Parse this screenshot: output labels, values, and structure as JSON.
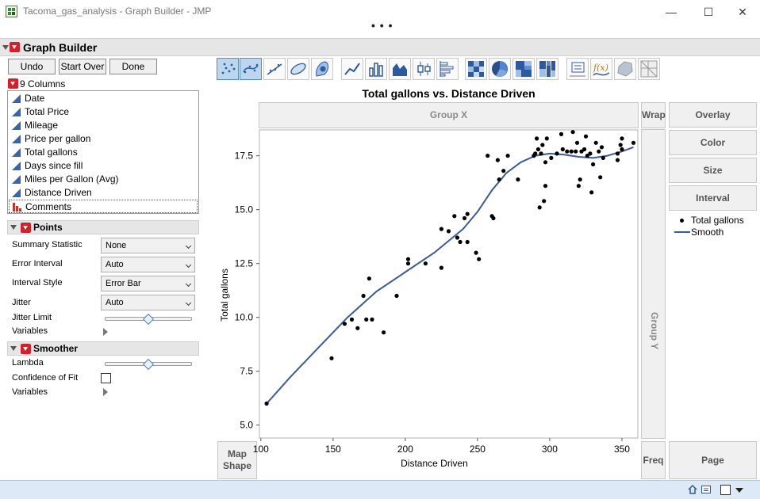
{
  "window": {
    "title": "Tacoma_gas_analysis - Graph Builder - JMP",
    "min": "—",
    "max": "☐",
    "close": "✕",
    "more": "• • •"
  },
  "header": {
    "title": "Graph Builder"
  },
  "buttons": {
    "undo": "Undo",
    "start_over": "Start Over",
    "done": "Done"
  },
  "columns": {
    "header": "9 Columns",
    "items": [
      {
        "label": "Date",
        "type": "continuous"
      },
      {
        "label": "Total Price",
        "type": "continuous"
      },
      {
        "label": "Mileage",
        "type": "continuous"
      },
      {
        "label": "Price per gallon",
        "type": "continuous"
      },
      {
        "label": "Total gallons",
        "type": "continuous"
      },
      {
        "label": "Days since fill",
        "type": "continuous"
      },
      {
        "label": "Miles per Gallon (Avg)",
        "type": "continuous"
      },
      {
        "label": "Distance Driven",
        "type": "continuous"
      },
      {
        "label": "Comments",
        "type": "nominal"
      }
    ]
  },
  "points_panel": {
    "title": "Points",
    "summary_statistic": {
      "label": "Summary Statistic",
      "value": "None"
    },
    "error_interval": {
      "label": "Error Interval",
      "value": "Auto"
    },
    "interval_style": {
      "label": "Interval Style",
      "value": "Error Bar"
    },
    "jitter": {
      "label": "Jitter",
      "value": "Auto"
    },
    "jitter_limit": {
      "label": "Jitter Limit",
      "level": 0.5
    },
    "variables": {
      "label": "Variables"
    }
  },
  "smoother_panel": {
    "title": "Smoother",
    "lambda": {
      "label": "Lambda",
      "level": 0.5
    },
    "confidence": {
      "label": "Confidence of Fit",
      "checked": false
    },
    "variables": {
      "label": "Variables"
    }
  },
  "toolbar": {
    "icons": [
      "points-icon",
      "smoother-icon",
      "line-of-fit-icon",
      "ellipse-icon",
      "contour-icon",
      "line-icon",
      "bar-icon",
      "area-icon",
      "box-plot-icon",
      "histogram-icon",
      "heatmap-icon",
      "pie-icon",
      "treemap-icon",
      "mosaic-icon",
      "caption-box-icon",
      "formula-icon",
      "map-shapes-icon",
      "map-lines-icon"
    ],
    "selected": [
      "points-icon",
      "smoother-icon"
    ],
    "formula_text": "f(x)"
  },
  "zones": {
    "group_x": "Group X",
    "wrap": "Wrap",
    "overlay": "Overlay",
    "color": "Color",
    "size": "Size",
    "interval": "Interval",
    "group_y": "Group Y",
    "map_shape_1": "Map",
    "map_shape_2": "Shape",
    "freq": "Freq",
    "page": "Page"
  },
  "legend": {
    "points": "Total gallons",
    "smooth": "Smooth"
  },
  "colors": {
    "accent": "#3a5a9a",
    "red": "#d61f2b",
    "points": "#000000"
  },
  "chart_data": {
    "type": "scatter",
    "title": "Total gallons vs. Distance Driven",
    "xlabel": "Distance Driven",
    "ylabel": "Total gallons",
    "xlim": [
      99,
      361
    ],
    "ylim": [
      4.4,
      18.7
    ],
    "x_ticks": [
      100,
      150,
      200,
      250,
      300,
      350
    ],
    "y_ticks": [
      5.0,
      7.5,
      10.0,
      12.5,
      15.0,
      17.5
    ],
    "x_tick_labels": [
      "100",
      "150",
      "200",
      "250",
      "300",
      "350"
    ],
    "y_tick_labels": [
      "5.0",
      "7.5",
      "10.0",
      "12.5",
      "15.0",
      "17.5"
    ],
    "series": [
      {
        "name": "Total gallons",
        "kind": "points",
        "x": [
          104,
          149,
          158,
          163,
          167,
          171,
          173,
          175,
          177,
          185,
          194,
          202,
          202,
          214,
          225,
          225,
          230,
          234,
          236,
          238,
          241,
          243,
          243,
          249,
          251,
          257,
          260,
          261,
          264,
          265,
          268,
          271,
          278,
          289,
          291,
          290,
          292,
          294,
          293,
          295,
          297,
          296,
          297,
          298,
          301,
          305,
          308,
          309,
          312,
          315,
          316,
          318,
          319,
          320,
          321,
          322,
          324,
          325,
          326,
          328,
          329,
          330,
          332,
          334,
          335,
          336,
          337,
          347,
          347,
          349,
          350,
          350,
          358
        ],
        "y": [
          6.0,
          8.1,
          9.7,
          9.9,
          9.5,
          11.0,
          9.9,
          11.8,
          9.9,
          9.3,
          11.0,
          12.5,
          12.7,
          12.5,
          12.3,
          14.1,
          14.0,
          14.7,
          13.7,
          13.5,
          14.6,
          13.5,
          14.8,
          13.0,
          12.7,
          17.5,
          14.7,
          14.6,
          17.3,
          16.4,
          16.8,
          17.5,
          16.4,
          17.5,
          18.3,
          17.6,
          17.8,
          17.6,
          15.1,
          18.0,
          16.1,
          15.4,
          17.2,
          18.3,
          17.4,
          17.6,
          18.5,
          17.8,
          17.7,
          17.7,
          18.6,
          17.7,
          18.1,
          16.1,
          16.4,
          17.7,
          17.8,
          18.4,
          17.5,
          17.6,
          15.8,
          17.1,
          18.1,
          17.7,
          16.5,
          17.9,
          17.4,
          17.6,
          17.3,
          18.0,
          18.3,
          17.8,
          18.1
        ]
      },
      {
        "name": "Smooth",
        "kind": "line",
        "x": [
          104,
          120,
          140,
          160,
          180,
          200,
          220,
          240,
          250,
          260,
          270,
          280,
          290,
          300,
          310,
          320,
          330,
          340,
          350,
          358
        ],
        "y": [
          6.0,
          7.2,
          8.6,
          10.0,
          11.2,
          12.1,
          13.0,
          14.1,
          14.9,
          15.9,
          16.7,
          17.2,
          17.5,
          17.6,
          17.55,
          17.45,
          17.4,
          17.5,
          17.7,
          17.9
        ]
      }
    ]
  }
}
